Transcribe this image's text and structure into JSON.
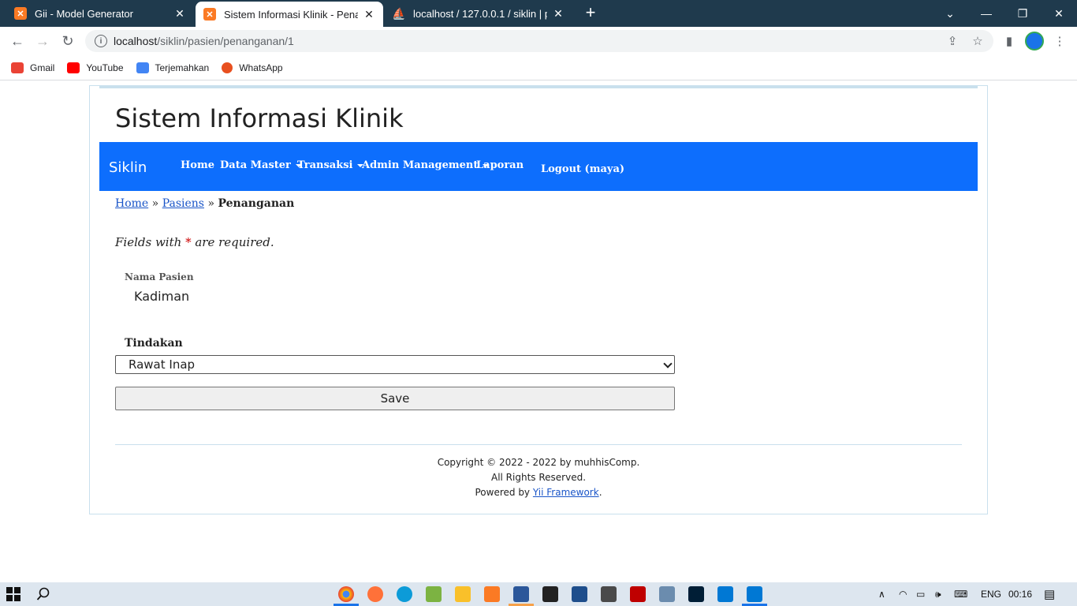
{
  "browser": {
    "tabs": [
      {
        "title": "Gii - Model Generator",
        "favicon": "xampp-icon",
        "active": false
      },
      {
        "title": "Sistem Informasi Klinik - Penanga",
        "favicon": "xampp-icon",
        "active": true
      },
      {
        "title": "localhost / 127.0.0.1 / siklin | php",
        "favicon": "phpmyadmin-icon",
        "active": false
      }
    ],
    "url_host": "localhost",
    "url_path": "/siklin/pasien/penanganan/1",
    "bookmarks": [
      {
        "label": "Gmail",
        "color": "#ea4335"
      },
      {
        "label": "YouTube",
        "color": "#ff0000"
      },
      {
        "label": "Terjemahkan",
        "color": "#4285f4"
      },
      {
        "label": "WhatsApp",
        "color": "#e8501f"
      }
    ]
  },
  "page": {
    "site_title": "Sistem Informasi Klinik",
    "navbar": {
      "brand": "Siklin",
      "items": [
        {
          "label": "Home",
          "dropdown": false
        },
        {
          "label": "Data Master",
          "dropdown": true
        },
        {
          "label": "Transaksi",
          "dropdown": true
        },
        {
          "label": "Admin Management",
          "dropdown": true
        },
        {
          "label": "Laporan",
          "dropdown": false
        }
      ],
      "logout": "Logout (maya)",
      "color": "#0d6efd"
    },
    "breadcrumb": {
      "home": "Home",
      "sep": "»",
      "parent": "Pasiens",
      "current": "Penanganan"
    },
    "note_prefix": "Fields with",
    "note_star": "*",
    "note_suffix": "are required.",
    "form": {
      "nama_label": "Nama Pasien",
      "nama_value": "Kadiman",
      "tindakan_label": "Tindakan",
      "tindakan_value": "Rawat Inap",
      "save_label": "Save"
    },
    "footer": {
      "line1": "Copyright © 2022 - 2022 by muhhisComp.",
      "line2": "All Rights Reserved.",
      "line3_prefix": "Powered by",
      "line3_link": "Yii Framework",
      "line3_suffix": "."
    }
  },
  "taskbar": {
    "language": "ENG",
    "time": "00:16"
  }
}
